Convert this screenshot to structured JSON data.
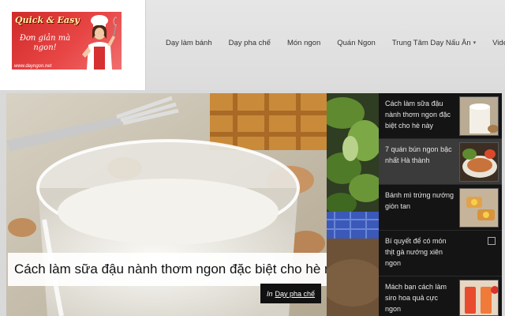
{
  "logo": {
    "title": "Quick & Easy",
    "tagline": "Đơn giản mà ngon!",
    "url": "www.dayngon.net"
  },
  "nav": {
    "items": [
      {
        "label": "Dạy làm bánh"
      },
      {
        "label": "Dạy pha chế"
      },
      {
        "label": "Món ngon"
      },
      {
        "label": "Quán Ngon"
      },
      {
        "label": "Trung Tâm Dạy Nấu Ăn",
        "has_dropdown": true
      },
      {
        "label": "Video"
      }
    ],
    "dropdown_icon": "chevron-down-icon"
  },
  "hero": {
    "caption": "Cách làm sữa đậu nành thơm ngon đặc biệt cho hè này",
    "category_prefix": "In",
    "category": "Dạy pha chế"
  },
  "sidebar": {
    "items": [
      {
        "title": "Cách làm sữa đậu nành thơm ngon đặc biệt cho hè này",
        "active": false
      },
      {
        "title": "7 quán bún ngon bậc nhất Hà thành",
        "active": true
      },
      {
        "title": "Bánh mì trứng nướng giòn tan",
        "active": false
      },
      {
        "title": "Bí quyết để có món thịt gà nướng xiên ngon",
        "active": false
      },
      {
        "title": "Mách bạn cách làm siro hoa quả cực ngon",
        "active": false
      }
    ]
  },
  "colors": {
    "header_bg": "#e3e3e3",
    "sidebar_bg": "#141414",
    "sidebar_active": "#3b3b3b",
    "logo_red": "#d02b2b"
  }
}
